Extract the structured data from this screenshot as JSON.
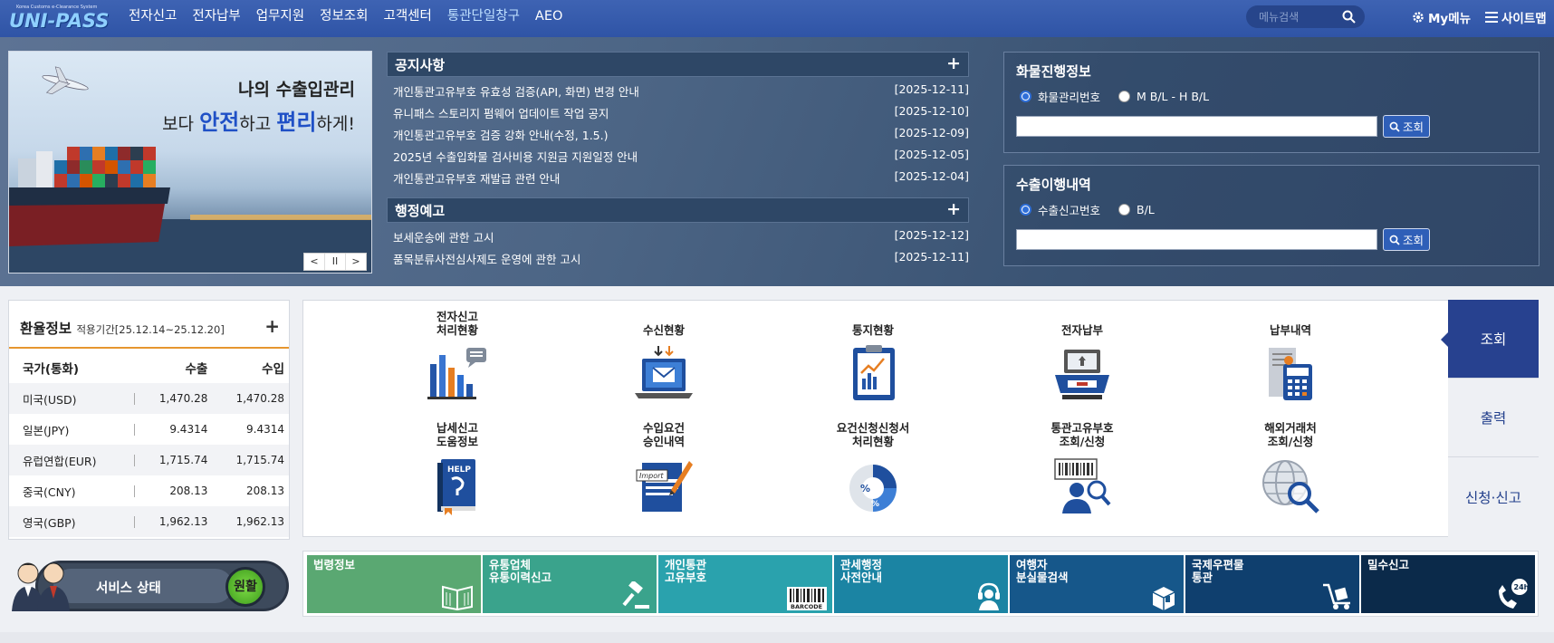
{
  "header": {
    "logo_tiny": "Korea Customs e-Clearance System",
    "logo_text": "UNI-PASS",
    "menu": [
      {
        "label": "전자신고"
      },
      {
        "label": "전자납부"
      },
      {
        "label": "업무지원"
      },
      {
        "label": "정보조회"
      },
      {
        "label": "고객센터"
      },
      {
        "label": "통관단일창구"
      },
      {
        "label": "AEO"
      }
    ],
    "search_placeholder": "메뉴검색",
    "mymenu_label": "My메뉴",
    "sitemap_label": "사이트맵"
  },
  "banner": {
    "line1": "나의 수출입관리",
    "line2_pre": "보다 ",
    "line2_b1": "안전",
    "line2_mid": "하고 ",
    "line2_b2": "편리",
    "line2_post": "하게!",
    "ctrl_prev": "<",
    "ctrl_pause": "II",
    "ctrl_next": ">"
  },
  "notice": {
    "title": "공지사항",
    "more": "+",
    "items": [
      {
        "title": "개인통관고유부호 유효성 검증(API, 화면) 변경 안내",
        "date": "[2025-12-11]"
      },
      {
        "title": "유니패스 스토리지 펌웨어 업데이트 작업 공지",
        "date": "[2025-12-10]"
      },
      {
        "title": "개인통관고유부호 검증 강화 안내(수정, 1.5.)",
        "date": "[2025-12-09]"
      },
      {
        "title": "2025년 수출입화물 검사비용 지원금 지원일정 안내",
        "date": "[2025-12-05]"
      },
      {
        "title": "개인통관고유부호 재발급 관련 안내",
        "date": "[2025-12-04]"
      }
    ]
  },
  "admin_notice": {
    "title": "행정예고",
    "more": "+",
    "items": [
      {
        "title": "보세운송에 관한 고시",
        "date": "[2025-12-12]"
      },
      {
        "title": "품목분류사전심사제도 운영에 관한 고시",
        "date": "[2025-12-11]"
      }
    ]
  },
  "cargo": {
    "title": "화물진행정보",
    "opt1": "화물관리번호",
    "opt2": "M B/L - H B/L",
    "button": "조회"
  },
  "export": {
    "title": "수출이행내역",
    "opt1": "수출신고번호",
    "opt2": "B/L",
    "button": "조회"
  },
  "exchange": {
    "title": "환율정보",
    "period": "적용기간[25.12.14~25.12.20]",
    "more": "+",
    "col_country": "국가(통화)",
    "col_export": "수출",
    "col_import": "수입",
    "rows": [
      {
        "country": "미국(USD)",
        "export": "1,470.28",
        "import": "1,470.28"
      },
      {
        "country": "일본(JPY)",
        "export": "9.4314",
        "import": "9.4314"
      },
      {
        "country": "유럽연합(EUR)",
        "export": "1,715.74",
        "import": "1,715.74"
      },
      {
        "country": "중국(CNY)",
        "export": "208.13",
        "import": "208.13"
      },
      {
        "country": "영국(GBP)",
        "export": "1,962.13",
        "import": "1,962.13"
      }
    ]
  },
  "service": {
    "label": "서비스 상태",
    "status": "원활"
  },
  "grid": {
    "items": [
      {
        "label": "전자신고\n처리현황",
        "icon": "bar-chart-icon"
      },
      {
        "label": "수신현황",
        "icon": "laptop-mail-icon"
      },
      {
        "label": "통지현황",
        "icon": "clipboard-chart-icon"
      },
      {
        "label": "전자납부",
        "icon": "payment-terminal-icon"
      },
      {
        "label": "납부내역",
        "icon": "calculator-receipt-icon"
      },
      {
        "label": "납세신고\n도움정보",
        "icon": "help-book-icon"
      },
      {
        "label": "수입요건\n승인내역",
        "icon": "import-approval-icon"
      },
      {
        "label": "요건신청신청서\n처리현황",
        "icon": "percent-pie-icon"
      },
      {
        "label": "통관고유부호\n조회/신청",
        "icon": "barcode-person-icon"
      },
      {
        "label": "해외거래처\n조회/신청",
        "icon": "globe-search-icon"
      }
    ]
  },
  "tabs": {
    "items": [
      {
        "label": "조회"
      },
      {
        "label": "출력"
      },
      {
        "label": "신청·신고"
      }
    ]
  },
  "shortcuts": {
    "items": [
      {
        "label": "법령정보",
        "color": "#5aa872",
        "icon": "book-icon"
      },
      {
        "label": "유통업체\n유통이력신고",
        "color": "#3aa38c",
        "icon": "gavel-icon"
      },
      {
        "label": "개인통관\n고유부호",
        "color": "#2aa2ad",
        "icon": "barcode-icon"
      },
      {
        "label": "관세행정\n사전안내",
        "color": "#1b84a3",
        "icon": "headset-icon"
      },
      {
        "label": "여행자\n분실물검색",
        "color": "#16578a",
        "icon": "package-icon"
      },
      {
        "label": "국제우편물\n통관",
        "color": "#0f3f6e",
        "icon": "cart-icon"
      },
      {
        "label": "밀수신고",
        "color": "#0b2a4a",
        "icon": "phone-24h-icon"
      }
    ],
    "phone_badge": "24h",
    "barcode_text": "BARCODE"
  }
}
